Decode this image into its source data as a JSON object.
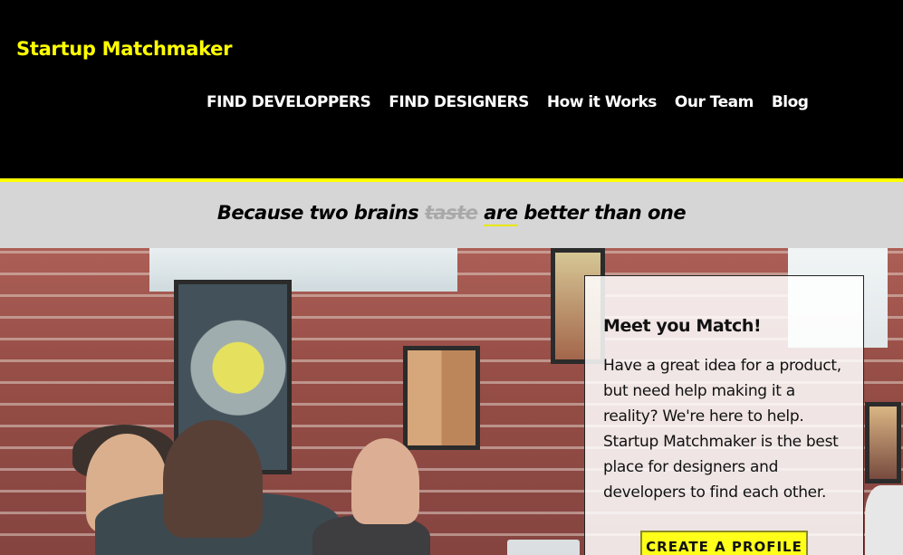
{
  "header": {
    "brand": "Startup Matchmaker",
    "nav": [
      "FIND DEVELOPPERS",
      "FIND DESIGNERS",
      "How it Works",
      "Our Team",
      "Blog"
    ]
  },
  "tagline": {
    "before": "Because two brains ",
    "struck": "taste",
    "space": " ",
    "underlined": "are",
    "after": " better than one"
  },
  "card": {
    "title": "Meet you Match!",
    "body": "Have a great idea for a product, but need help making it a reality? We're here to help. Startup Matchmaker is the best place for designers and developers to find each other.",
    "cta": "CREATE A PROFILE"
  },
  "colors": {
    "brand": "#ffff00",
    "header_bg": "#000000",
    "band_bg": "#d6d6d6",
    "cta_bg": "#ffff1a"
  }
}
